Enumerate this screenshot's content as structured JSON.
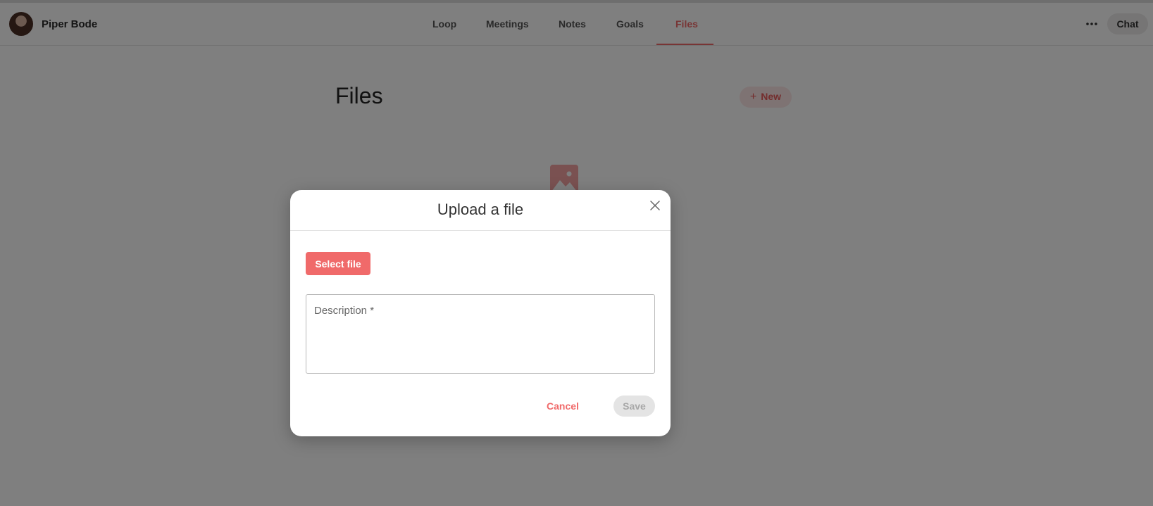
{
  "header": {
    "user_name": "Piper Bode",
    "avatar_icon": "user-avatar",
    "tabs": [
      {
        "label": "Loop",
        "active": false
      },
      {
        "label": "Meetings",
        "active": false
      },
      {
        "label": "Notes",
        "active": false
      },
      {
        "label": "Goals",
        "active": false
      },
      {
        "label": "Files",
        "active": true
      }
    ],
    "more_icon": "ellipsis-icon",
    "chat_label": "Chat"
  },
  "main": {
    "title": "Files",
    "new_label": "New",
    "empty_state_icon": "image-icon"
  },
  "modal": {
    "title": "Upload a file",
    "close_icon": "close-icon",
    "select_file_label": "Select file",
    "description_placeholder": "Description *",
    "description_value": "",
    "cancel_label": "Cancel",
    "save_label": "Save",
    "save_disabled": true
  },
  "colors": {
    "accent": "#f06a6a",
    "overlay": "rgba(0,0,0,0.5)",
    "disabled_button": "#e4e4e4"
  }
}
